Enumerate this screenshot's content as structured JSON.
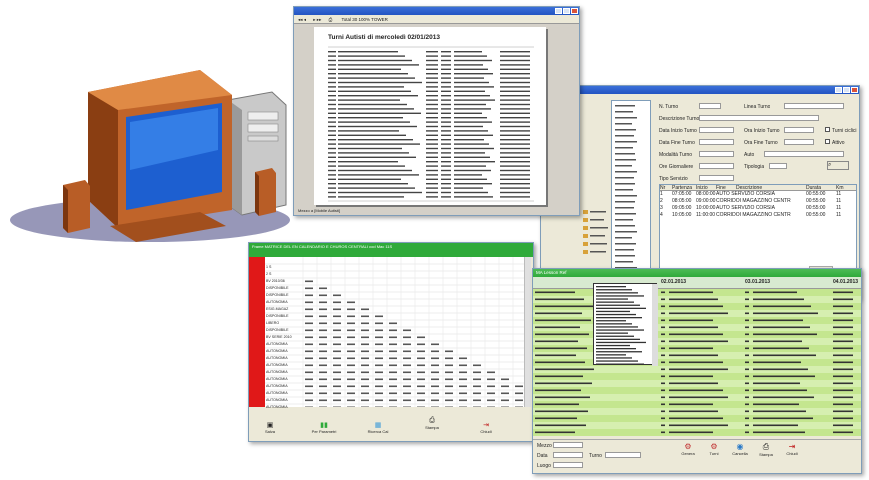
{
  "report_window": {
    "toolbar_text": "Total 30    100%    TOWER",
    "heading": "Turni Autisti di mercoledì 02/01/2013",
    "footer": "Mezzo a [Mobile Autisti]",
    "rows": 34
  },
  "grid_window": {
    "title": "Frame  MATRICE DEL EN CALENDARIO E  CHUROS CENTRALI   cod Mac 11S",
    "row_labels": [
      "",
      "1 S",
      "2 S",
      "BV 2010/36",
      "DISPONIBILE",
      "DISPONIBILE",
      "AUTONOMIA",
      "ESIG.MAGAZ",
      "DISPONIBILE",
      "LIBERO",
      "DISPONIBILE",
      "BV SERIE 2010",
      "AUTONOMIA",
      "AUTONOMIA",
      "AUTONOMIA",
      "AUTONOMIA",
      "AUTONOMIA",
      "AUTONOMIA",
      "AUTONOMIA",
      "AUTONOMIA",
      "AUTONOMIA",
      "AUTONOMIA"
    ],
    "buttons": [
      "Salva",
      "Per Parametri",
      "Ricerca Cal",
      "Stampa",
      "Chiudi"
    ]
  },
  "form_window": {
    "labels": [
      "N. Turno",
      "Linea Turno",
      "Descrizione Turno",
      "Data Inizio Turno",
      "Ora Inizio Turno",
      "Data Fine Turno",
      "Ora Fine Turno",
      "Modalità Turno",
      "Auto",
      "Ore Giornaliere",
      "Tipologia",
      "Tipo Servizio"
    ],
    "checkboxes": [
      "Turni ciclici",
      "Attivo"
    ],
    "table_headers": [
      "Nr",
      "Partenza",
      "Inizio",
      "Fine",
      "Descrizione",
      "Durata",
      "Km"
    ],
    "rows": [
      {
        "nr": "1",
        "start": "07:05:00",
        "end": "08:00:00",
        "desc": "AUTO SERVIZIO CORSIA",
        "dur": "00:55:00",
        "km": "11"
      },
      {
        "nr": "2",
        "start": "08:05:00",
        "end": "09:00:00",
        "desc": "CORRIDOI MAGAZZINO CENTR",
        "dur": "00:55:00",
        "km": "11"
      },
      {
        "nr": "3",
        "start": "09:05:00",
        "end": "10:00:00",
        "desc": "AUTO SERVIZIO CORSIA",
        "dur": "00:55:00",
        "km": "11"
      },
      {
        "nr": "4",
        "start": "10:05:00",
        "end": "11:00:00",
        "desc": "CORRIDOI MAGAZZINO CENTR",
        "dur": "00:55:00",
        "km": "11"
      }
    ],
    "close_label": "Elimina"
  },
  "schedule_window": {
    "title": "MA Lesson Ref",
    "date_headers": [
      "02.01.2013",
      "03.01.2013",
      "04.01.2013"
    ],
    "footer_fields": [
      "Mezzo",
      "Data",
      "Luogo",
      "Turno"
    ],
    "buttons": [
      "Genera",
      "Turni",
      "Cancella",
      "Stampa",
      "Chiudi"
    ]
  },
  "colors": {
    "title_blue": "#2254c2",
    "grid_green": "#2faa3a",
    "row_red": "#e01818",
    "schedule_green": "#cfe9a2",
    "window_bg": "#ece9d8"
  }
}
